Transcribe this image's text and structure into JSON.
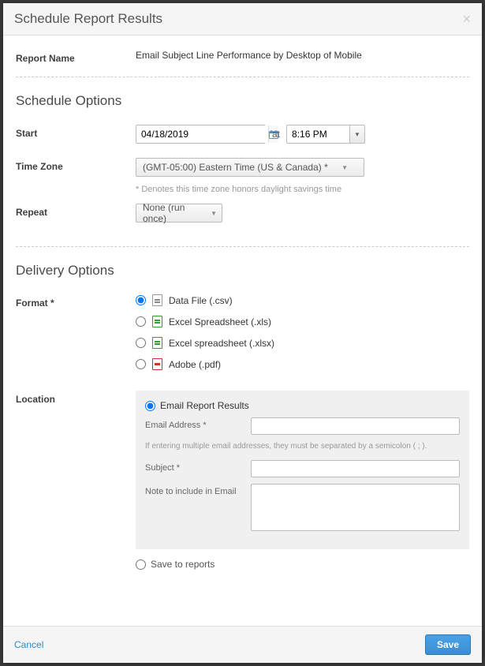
{
  "modal": {
    "title": "Schedule Report Results",
    "close_icon": "×"
  },
  "report": {
    "name_label": "Report Name",
    "name_value": "Email Subject Line Performance by Desktop of Mobile"
  },
  "schedule": {
    "section_title": "Schedule Options",
    "start_label": "Start",
    "start_date": "04/18/2019",
    "at_text": "at",
    "start_time": "8:16 PM",
    "timezone_label": "Time Zone",
    "timezone_value": "(GMT-05:00) Eastern Time (US & Canada) *",
    "timezone_note": "* Denotes this time zone honors daylight savings time",
    "repeat_label": "Repeat",
    "repeat_value": "None (run once)"
  },
  "delivery": {
    "section_title": "Delivery Options",
    "format_label": "Format *",
    "formats": [
      {
        "label": "Data File (.csv)",
        "selected": true
      },
      {
        "label": "Excel Spreadsheet (.xls)",
        "selected": false
      },
      {
        "label": "Excel spreadsheet (.xlsx)",
        "selected": false
      },
      {
        "label": "Adobe (.pdf)",
        "selected": false
      }
    ],
    "location_label": "Location",
    "email_option_label": "Email Report Results",
    "email_address_label": "Email Address *",
    "email_hint": "If entering multiple email addresses, they must be separated by a semicolon ( ; ).",
    "subject_label": "Subject *",
    "note_label": "Note to include in Email",
    "save_option_label": "Save to reports"
  },
  "footer": {
    "cancel_label": "Cancel",
    "save_label": "Save"
  }
}
